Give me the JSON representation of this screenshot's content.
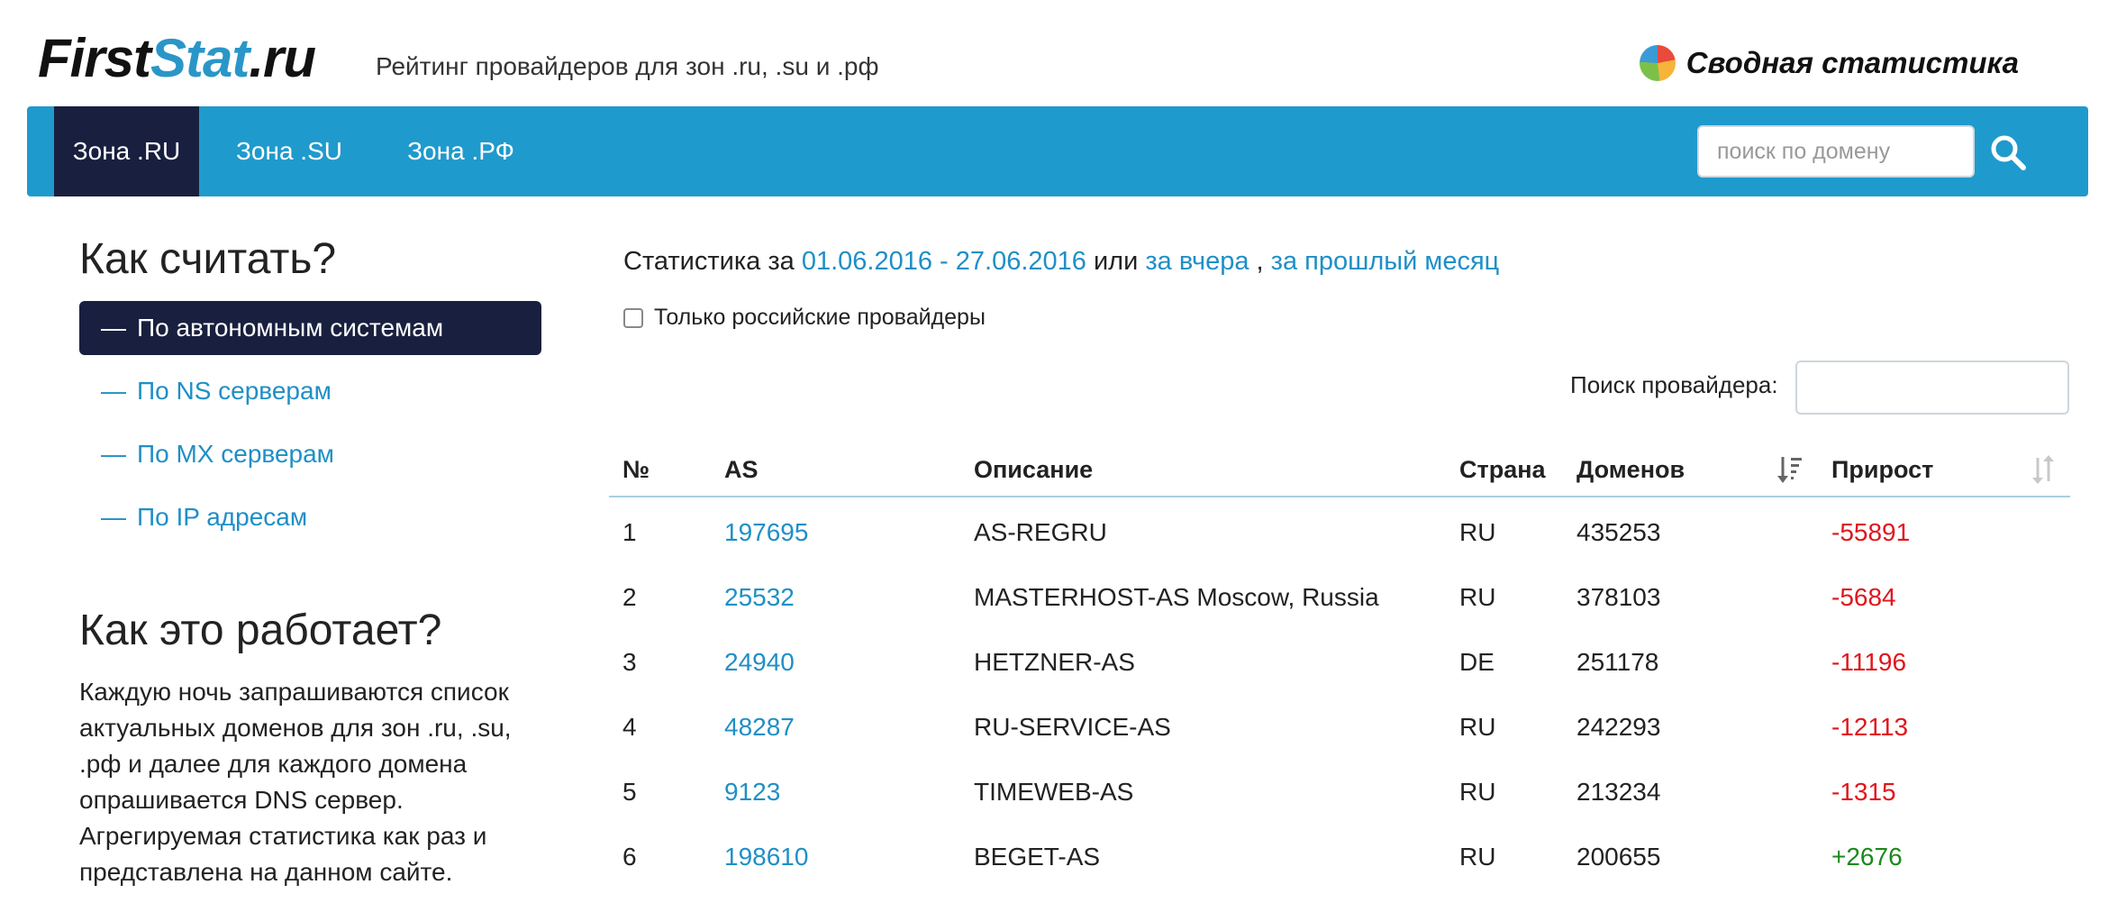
{
  "header": {
    "logo_part1": "First",
    "logo_part2": "Stat",
    "logo_part3": ".ru",
    "tagline": "Рейтинг провайдеров для зон .ru, .su и .рф",
    "summary_label": "Сводная статистика",
    "summary_icon": "pie-chart-icon"
  },
  "nav": {
    "tabs": [
      {
        "label": "Зона .RU",
        "active": true
      },
      {
        "label": "Зона .SU",
        "active": false
      },
      {
        "label": "Зона .РФ",
        "active": false
      }
    ],
    "search_placeholder": "поиск по домену",
    "search_icon": "search-icon"
  },
  "sidebar": {
    "how_title": "Как считать?",
    "items": [
      {
        "dash": "—",
        "label": "По автономным системам",
        "active": true
      },
      {
        "dash": "—",
        "label": "По NS серверам",
        "active": false
      },
      {
        "dash": "—",
        "label": "По MX серверам",
        "active": false
      },
      {
        "dash": "—",
        "label": "По IP адресам",
        "active": false
      }
    ],
    "works_title": "Как это работает?",
    "works_text": "Каждую ночь запрашиваются список актуальных доменов для зон .ru, .su, .рф и далее для каждого домена опрашивается DNS сервер. Агрегируемая статистика как раз и представлена на данном сайте."
  },
  "main": {
    "stats_prefix": "Статистика за",
    "stats_period": "01.06.2016 - 27.06.2016",
    "stats_or": "или",
    "stats_yesterday": "за вчера",
    "stats_comma": ",",
    "stats_last_month": "за прошлый месяц",
    "only_ru_label": "Только российские провайдеры",
    "only_ru_checked": false,
    "provider_search_label": "Поиск провайдера:",
    "provider_search_value": ""
  },
  "table": {
    "headers": {
      "num": "№",
      "as": "AS",
      "desc": "Описание",
      "country": "Страна",
      "domains": "Доменов",
      "growth": "Прирост"
    },
    "colors": {
      "link": "#1f8fc6",
      "negative": "#e0161c",
      "positive": "#1a8a1a"
    },
    "rows": [
      {
        "num": "1",
        "as": "197695",
        "desc": "AS-REGRU",
        "country": "RU",
        "domains": "435253",
        "growth": "-55891",
        "growth_sign": "neg"
      },
      {
        "num": "2",
        "as": "25532",
        "desc": "MASTERHOST-AS Moscow, Russia",
        "country": "RU",
        "domains": "378103",
        "growth": "-5684",
        "growth_sign": "neg"
      },
      {
        "num": "3",
        "as": "24940",
        "desc": "HETZNER-AS",
        "country": "DE",
        "domains": "251178",
        "growth": "-11196",
        "growth_sign": "neg"
      },
      {
        "num": "4",
        "as": "48287",
        "desc": "RU-SERVICE-AS",
        "country": "RU",
        "domains": "242293",
        "growth": "-12113",
        "growth_sign": "neg"
      },
      {
        "num": "5",
        "as": "9123",
        "desc": "TIMEWEB-AS",
        "country": "RU",
        "domains": "213234",
        "growth": "-1315",
        "growth_sign": "neg"
      },
      {
        "num": "6",
        "as": "198610",
        "desc": "BEGET-AS",
        "country": "RU",
        "domains": "200655",
        "growth": "+2676",
        "growth_sign": "pos"
      }
    ]
  }
}
